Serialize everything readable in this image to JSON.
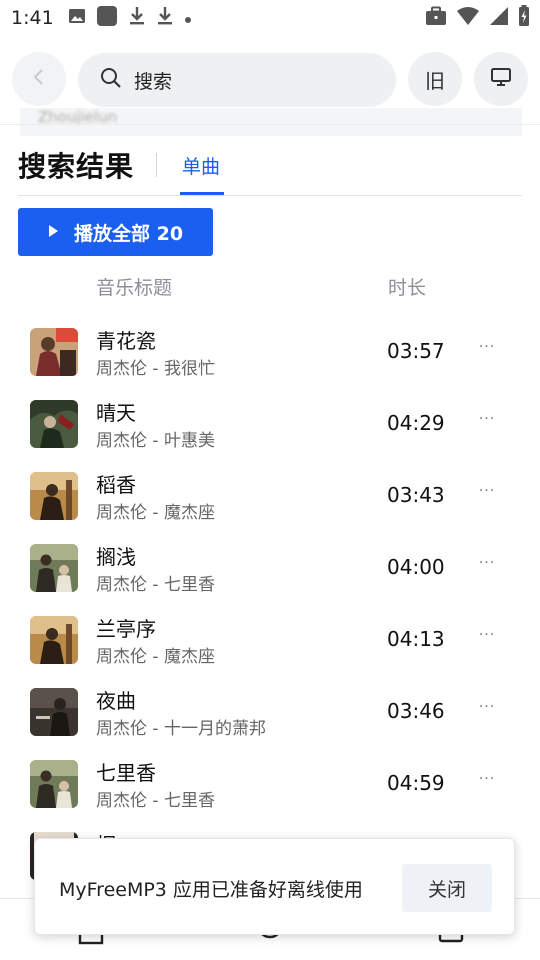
{
  "status_bar": {
    "time": "1:41",
    "left_icons": [
      "image-icon",
      "app-icon",
      "download-icon",
      "download-icon",
      "dot-icon"
    ],
    "right_icons": [
      "briefcase-icon",
      "wifi-icon",
      "signal-icon",
      "battery-icon"
    ]
  },
  "header": {
    "search_placeholder": "搜索",
    "history_label": "旧",
    "ghost_text": "Zhoujielun"
  },
  "tabs": {
    "results_title": "搜索结果",
    "active_tab": "单曲"
  },
  "play_all_label": "播放全部 20",
  "columns": {
    "title": "音乐标题",
    "duration": "时长"
  },
  "songs": [
    {
      "title": "青花瓷",
      "subtitle": "周杰伦 - 我很忙",
      "duration": "03:57",
      "more": "···"
    },
    {
      "title": "晴天",
      "subtitle": "周杰伦 - 叶惠美",
      "duration": "04:29",
      "more": "···"
    },
    {
      "title": "稻香",
      "subtitle": "周杰伦 - 魔杰座",
      "duration": "03:43",
      "more": "···"
    },
    {
      "title": "搁浅",
      "subtitle": "周杰伦 - 七里香",
      "duration": "04:00",
      "more": "···"
    },
    {
      "title": "兰亭序",
      "subtitle": "周杰伦 - 魔杰座",
      "duration": "04:13",
      "more": "···"
    },
    {
      "title": "夜曲",
      "subtitle": "周杰伦 - 十一月的萧邦",
      "duration": "03:46",
      "more": "···"
    },
    {
      "title": "七里香",
      "subtitle": "周杰伦 - 七里香",
      "duration": "04:59",
      "more": "···"
    },
    {
      "title": "烟",
      "subtitle": "",
      "duration": "",
      "more": ""
    }
  ],
  "toast": {
    "message": "MyFreeMP3 应用已准备好离线使用",
    "close_label": "关闭"
  },
  "colors": {
    "accent": "#1a5ff0",
    "muted_text": "#8a8f99",
    "pill_bg": "#eef0f2"
  }
}
